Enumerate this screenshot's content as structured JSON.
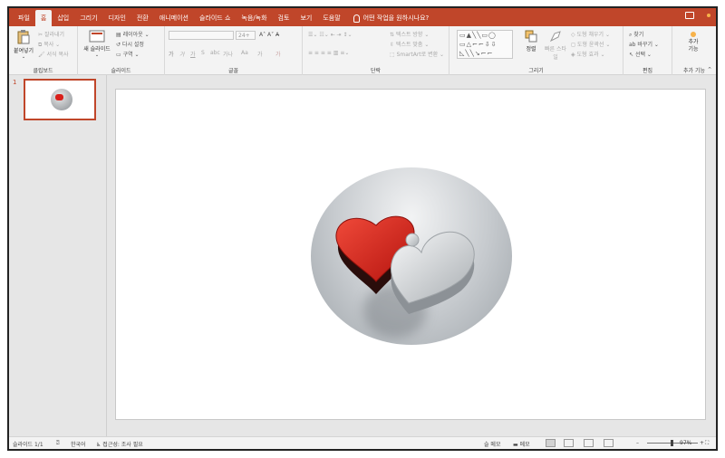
{
  "tabs": [
    "파일",
    "홈",
    "삽입",
    "그리기",
    "디자인",
    "전환",
    "애니메이션",
    "슬라이드 쇼",
    "녹음/녹화",
    "검토",
    "보기",
    "도움말"
  ],
  "active_tab": "홈",
  "tell_me": "어떤 작업을 원하시나요?",
  "ribbon": {
    "clipboard": {
      "paste": "붙여넣기",
      "cut": "잘라내기",
      "copy": "복사",
      "format_painter": "서식 복사",
      "label": "클립보드"
    },
    "slides": {
      "new_slide": "새 슬라이드",
      "layout": "레이아웃",
      "reset": "다시 설정",
      "section": "구역",
      "label": "슬라이드"
    },
    "font": {
      "label": "글꼴",
      "size": "24+",
      "bold": "가",
      "italic": "가",
      "underline": "가",
      "strike": "S",
      "spacing": "가나",
      "case": "Aa",
      "highlight": "가",
      "color": "가"
    },
    "paragraph": {
      "label": "단락",
      "text_direction": "텍스트 방향",
      "align_text": "텍스트 맞춤",
      "smartart": "SmartArt로 변환"
    },
    "drawing": {
      "label": "그리기",
      "arrange": "정렬",
      "quick_styles": "빠른 스타일",
      "fill": "도형 채우기",
      "outline": "도형 윤곽선",
      "effects": "도형 효과"
    },
    "editing": {
      "label": "편집",
      "find": "찾기",
      "replace": "바꾸기",
      "select": "선택"
    },
    "addins": {
      "label": "추가 기능",
      "button": "추가 기능"
    }
  },
  "thumbnails": [
    {
      "number": "1"
    }
  ],
  "status": {
    "slide_count": "슬라이드 1/1",
    "language": "한국어",
    "accessibility": "접근성: 조사 필요",
    "notes": "슬 메모",
    "comments": "메모",
    "zoom": "97%"
  },
  "colors": {
    "accent": "#c0462a",
    "heart_red": "#d9201b",
    "heart_silver": "#d7dadc"
  }
}
